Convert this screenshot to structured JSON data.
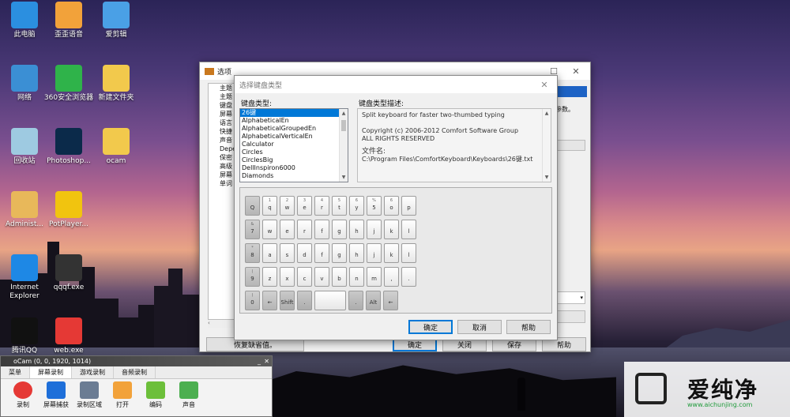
{
  "desktop": {
    "icons": [
      {
        "label": "此电脑",
        "icon": "computer-icon",
        "color": "#2b8fe0"
      },
      {
        "label": "歪歪语音",
        "icon": "yy-voice-icon",
        "color": "#f2a23a"
      },
      {
        "label": "爱剪辑",
        "icon": "aijianji-icon",
        "color": "#4aa0e6"
      },
      {
        "label": "网络",
        "icon": "network-icon",
        "color": "#3b8fd4"
      },
      {
        "label": "360安全浏览器",
        "icon": "360-browser-icon",
        "color": "#2fb34a"
      },
      {
        "label": "新建文件夹",
        "icon": "folder-icon",
        "color": "#f2c94c"
      },
      {
        "label": "回收站",
        "icon": "recycle-bin-icon",
        "color": "#9ecae1"
      },
      {
        "label": "Photoshop...",
        "icon": "photoshop-icon",
        "color": "#0b2a4a"
      },
      {
        "label": "ocam",
        "icon": "folder-icon",
        "color": "#f2c94c"
      },
      {
        "label": "Administ...",
        "icon": "user-folder-icon",
        "color": "#e8b85a"
      },
      {
        "label": "PotPlayer...",
        "icon": "potplayer-icon",
        "color": "#f1c40f"
      },
      {
        "label": "Internet Explorer",
        "icon": "ie-icon",
        "color": "#1e88e5"
      },
      {
        "label": "qqqf.exe",
        "icon": "qqqf-icon",
        "color": "#333333"
      },
      {
        "label": "腾讯QQ",
        "icon": "qq-icon",
        "color": "#111111"
      },
      {
        "label": "web.exe",
        "icon": "web-exe-icon",
        "color": "#e53935"
      }
    ]
  },
  "options_window": {
    "title": "选项",
    "tree_items": [
      "主题",
      "主题",
      "键盘",
      "屏幕",
      "语言",
      "快捷",
      "声音",
      "Depe",
      "保密",
      "高级",
      "屏幕",
      "单词"
    ],
    "right_text": "参数。",
    "buttons": {
      "reset": "恢复缺省值。",
      "ok": "确定",
      "close": "关闭",
      "save": "保存",
      "help": "帮助"
    }
  },
  "keyboard_dialog": {
    "title": "选择键盘类型",
    "type_label": "键盘类型:",
    "desc_label": "键盘类型描述:",
    "types": [
      "26键",
      "AlphabeticalEn",
      "AlphabeticalGroupedEn",
      "AlphabeticalVerticalEn",
      "Calculator",
      "Circles",
      "CirclesBig",
      "DellInspiron6000",
      "Diamonds"
    ],
    "description": "Split keyboard for faster two-thumbed typing",
    "copyright": "Copyright (c) 2006-2012  Comfort Software Group",
    "rights": "ALL RIGHTS RESERVED",
    "file_label": "文件名:",
    "file_path": "C:\\Program Files\\ComfortKeyboard\\Keyboards\\26键.txt",
    "buttons": {
      "ok": "确定",
      "cancel": "取消",
      "help": "帮助"
    },
    "keys": {
      "row1": [
        {
          "t": "",
          "m": "Q"
        },
        {
          "t": "1",
          "m": "q"
        },
        {
          "t": "2",
          "m": "w"
        },
        {
          "t": "3",
          "m": "e"
        },
        {
          "t": "4",
          "m": "r"
        },
        {
          "t": "5",
          "m": "t"
        },
        {
          "t": "6",
          "m": "y"
        },
        {
          "t": "%",
          "m": "5"
        },
        {
          "t": "6",
          "m": "o"
        },
        {
          "t": "",
          "m": "p"
        }
      ],
      "row2": [
        {
          "t": "&",
          "m": "7"
        },
        {
          "t": "",
          "m": "w"
        },
        {
          "t": "",
          "m": "e"
        },
        {
          "t": "",
          "m": "r"
        },
        {
          "t": "",
          "m": "f"
        },
        {
          "t": "",
          "m": "g"
        },
        {
          "t": "",
          "m": "h"
        },
        {
          "t": "",
          "m": "j"
        },
        {
          "t": "",
          "m": "k"
        },
        {
          "t": "",
          "m": "l"
        }
      ],
      "row3": [
        {
          "t": "*",
          "m": "8"
        },
        {
          "t": "",
          "m": "a"
        },
        {
          "t": "",
          "m": "s"
        },
        {
          "t": "",
          "m": "d"
        },
        {
          "t": "",
          "m": "f"
        },
        {
          "t": "",
          "m": "g"
        },
        {
          "t": "",
          "m": "h"
        },
        {
          "t": "",
          "m": "j"
        },
        {
          "t": "",
          "m": "k"
        },
        {
          "t": "",
          "m": "l"
        }
      ],
      "row4": [
        {
          "t": "(",
          "m": "9"
        },
        {
          "t": "",
          "m": "z"
        },
        {
          "t": "",
          "m": "x"
        },
        {
          "t": "",
          "m": "c"
        },
        {
          "t": "",
          "m": "v"
        },
        {
          "t": "",
          "m": "b"
        },
        {
          "t": "",
          "m": "n"
        },
        {
          "t": "",
          "m": "m"
        },
        {
          "t": "",
          "m": ","
        },
        {
          "t": "",
          "m": "."
        }
      ],
      "row5": [
        {
          "t": ")",
          "m": "0"
        },
        {
          "t": "",
          "m": "←"
        },
        {
          "t": "",
          "m": "Shift"
        },
        {
          "t": "",
          "m": "."
        },
        {
          "t": "",
          "m": ""
        },
        {
          "t": "",
          "m": "."
        },
        {
          "t": "",
          "m": "Alt"
        },
        {
          "t": "",
          "m": "←"
        }
      ]
    }
  },
  "ocam": {
    "title": "oCam (0, 0, 1920, 1014)",
    "tabs": [
      "菜单",
      "屏幕录制",
      "游戏录制",
      "音频录制"
    ],
    "tools": [
      {
        "label": "录制",
        "icon": "record-icon",
        "color": "#e53935"
      },
      {
        "label": "屏幕捕获",
        "icon": "screen-capture-icon",
        "color": "#1e6fd9"
      },
      {
        "label": "录制区域",
        "icon": "record-area-icon",
        "color": "#6b7c93"
      },
      {
        "label": "打开",
        "icon": "open-folder-icon",
        "color": "#f2a23a"
      },
      {
        "label": "编码",
        "icon": "codec-icon",
        "color": "#6cbf3a"
      },
      {
        "label": "声音",
        "icon": "microphone-icon",
        "color": "#4caf50"
      }
    ]
  },
  "watermark": {
    "name": "爱纯净",
    "url": "www.aichunjing.com"
  }
}
